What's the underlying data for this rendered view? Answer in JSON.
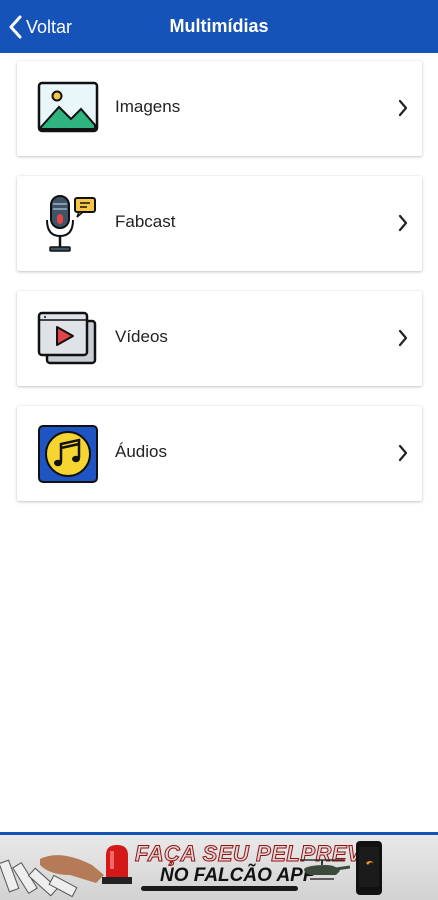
{
  "header": {
    "back_label": "Voltar",
    "title": "Multimídias",
    "bg_color": "#1553b8"
  },
  "menu": {
    "items": [
      {
        "label": "Imagens",
        "icon": "image-icon"
      },
      {
        "label": "Fabcast",
        "icon": "microphone-icon"
      },
      {
        "label": "Vídeos",
        "icon": "video-play-icon"
      },
      {
        "label": "Áudios",
        "icon": "music-note-icon"
      }
    ]
  },
  "banner": {
    "line1": "FAÇA SEU PELPREV",
    "line2": "NO FALCÃO APP"
  }
}
